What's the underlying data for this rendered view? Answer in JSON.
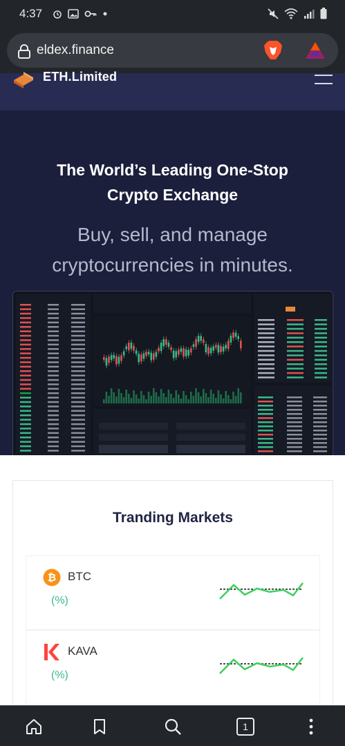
{
  "status_bar": {
    "time": "4:37",
    "left_icons": [
      "alarm-icon",
      "image-icon",
      "key-icon",
      "dot-icon"
    ],
    "right_icons": [
      "mute-icon",
      "wifi-icon",
      "signal-icon",
      "battery-icon"
    ]
  },
  "browser": {
    "url": "eldex.finance",
    "icons": [
      "lock-icon",
      "brave-lion-icon",
      "bat-rewards-icon"
    ]
  },
  "site_header": {
    "logo_text": "ETH.Limited",
    "menu_icon": "hamburger-icon"
  },
  "hero": {
    "title_line1": "The World’s Leading One-Stop",
    "title_line2": "Crypto Exchange",
    "subtitle_line1": "Buy, sell, and manage",
    "subtitle_line2": "cryptocurrencies in minutes."
  },
  "markets": {
    "title": "Tranding Markets",
    "items": [
      {
        "name": "BTC",
        "change": "(%)",
        "icon": "bitcoin-icon"
      },
      {
        "name": "KAVA",
        "change": "(%)",
        "icon": "kava-icon"
      }
    ]
  },
  "bottom_nav": {
    "tab_count": "1",
    "icons": [
      "home-icon",
      "bookmark-icon",
      "search-icon",
      "tabs-icon",
      "more-icon"
    ]
  },
  "colors": {
    "hero_bg": "#1b1f3c",
    "header_bg": "#282c52",
    "positive": "#3bb98b",
    "spark": "#3ecf5f"
  }
}
